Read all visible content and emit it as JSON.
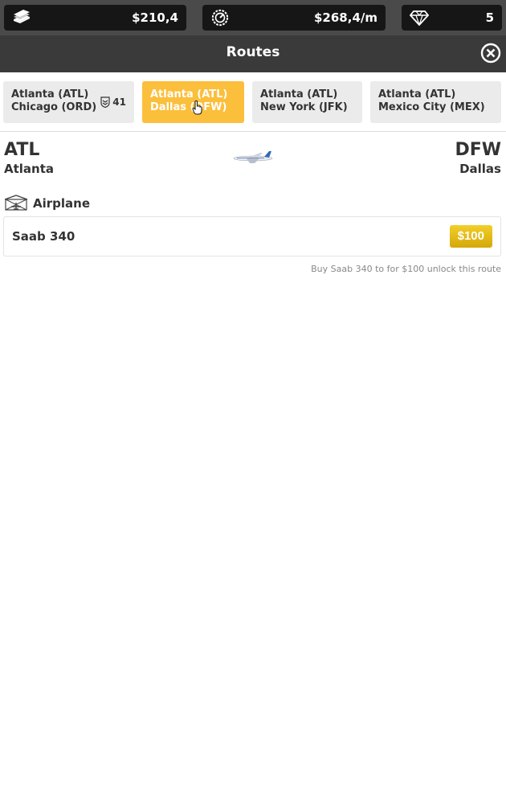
{
  "stats": {
    "cash": "$210,4",
    "income": "$268,4/m",
    "gems": "5"
  },
  "header": {
    "title": "Routes"
  },
  "routes": [
    {
      "line1": "Atlanta (ATL)",
      "line2": "Chicago (ORD)",
      "badge": "41",
      "active": false
    },
    {
      "line1": "Atlanta (ATL)",
      "line2": "Dallas (DFW)",
      "active": true
    },
    {
      "line1": "Atlanta (ATL)",
      "line2": "New York (JFK)",
      "active": false
    },
    {
      "line1": "Atlanta (ATL)",
      "line2": "Mexico City (MEX)",
      "active": false
    }
  ],
  "selected_route": {
    "origin_code": "ATL",
    "origin_city": "Atlanta",
    "dest_code": "DFW",
    "dest_city": "Dallas"
  },
  "airplane_section": {
    "label": "Airplane",
    "plane_name": "Saab 340",
    "price": "$100",
    "hint": "Buy Saab 340 to for $100 unlock this route"
  },
  "colors": {
    "active_tab": "#fbbf3c",
    "buy_button": "#e0b815",
    "topbar": "#4a4a4a",
    "titlebar": "#3a3a3a"
  }
}
